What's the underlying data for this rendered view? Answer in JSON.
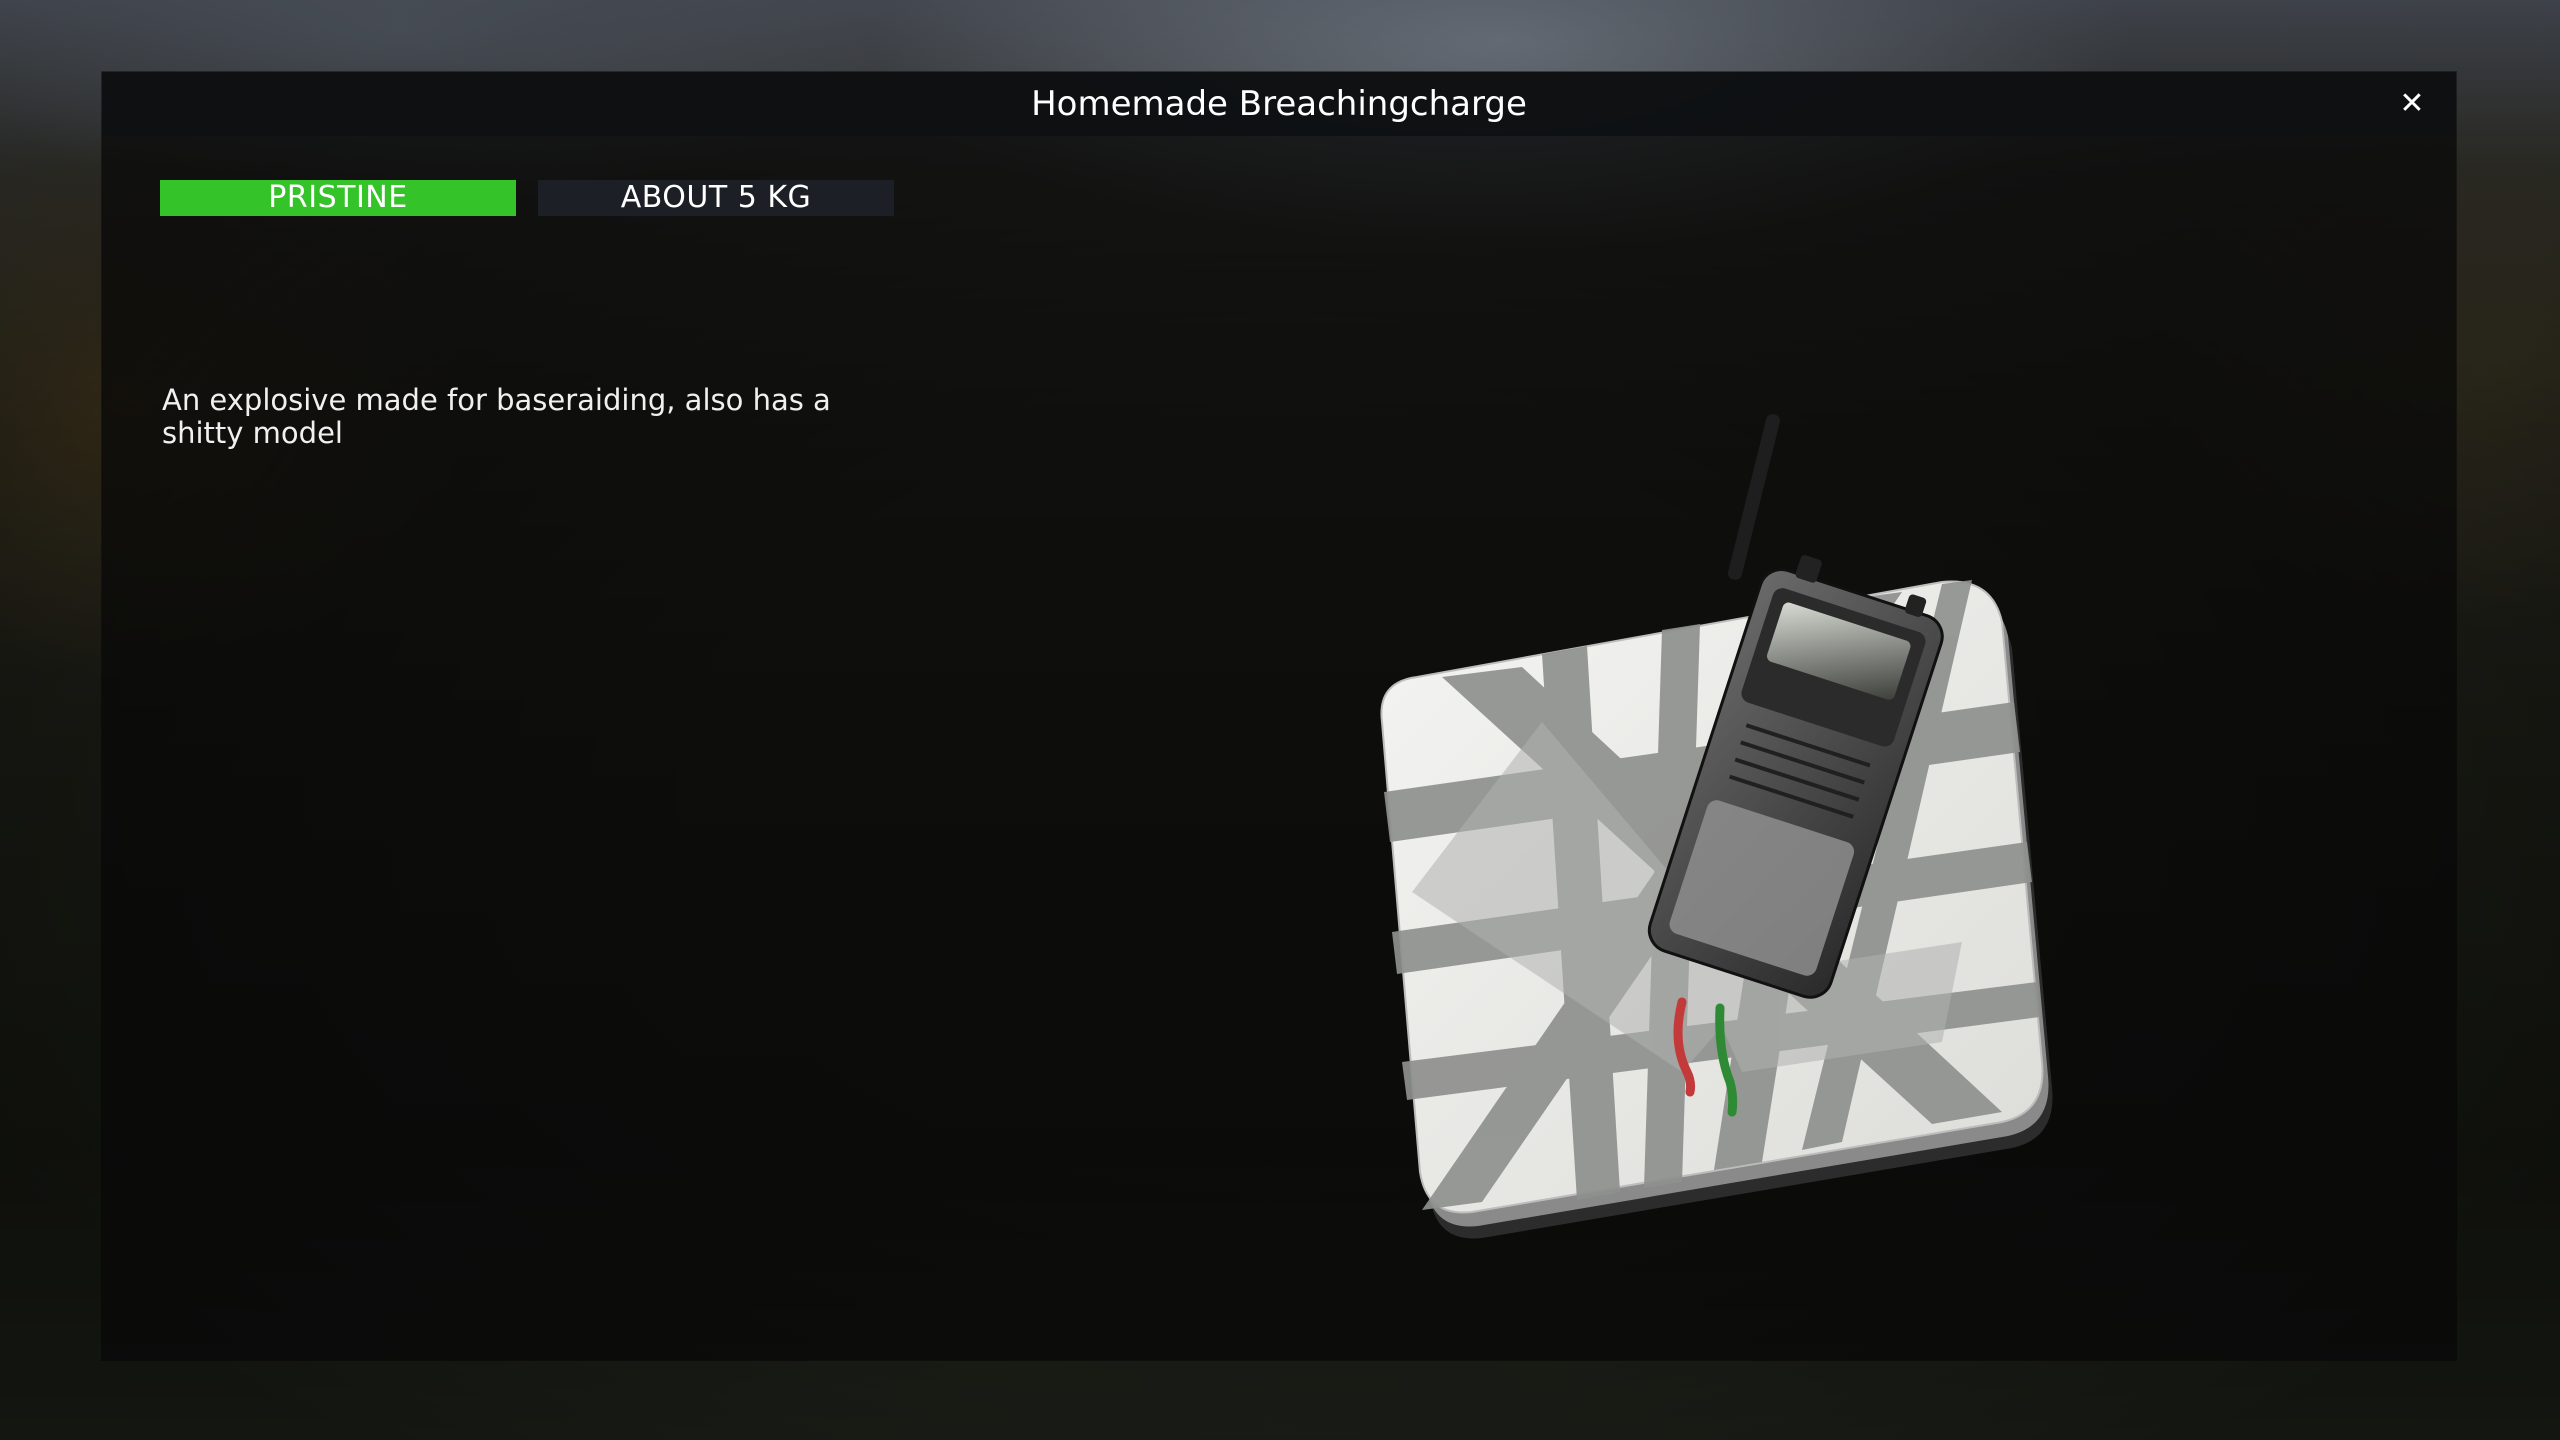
{
  "window": {
    "title": "Homemade Breachingcharge",
    "close_icon": "close-icon"
  },
  "item": {
    "condition": "PRISTINE",
    "condition_color": "#35c32a",
    "weight": "ABOUT 5 KG",
    "description": "An explosive made for baseraiding, also has a shitty model",
    "preview_icon": "breaching-charge-model"
  }
}
